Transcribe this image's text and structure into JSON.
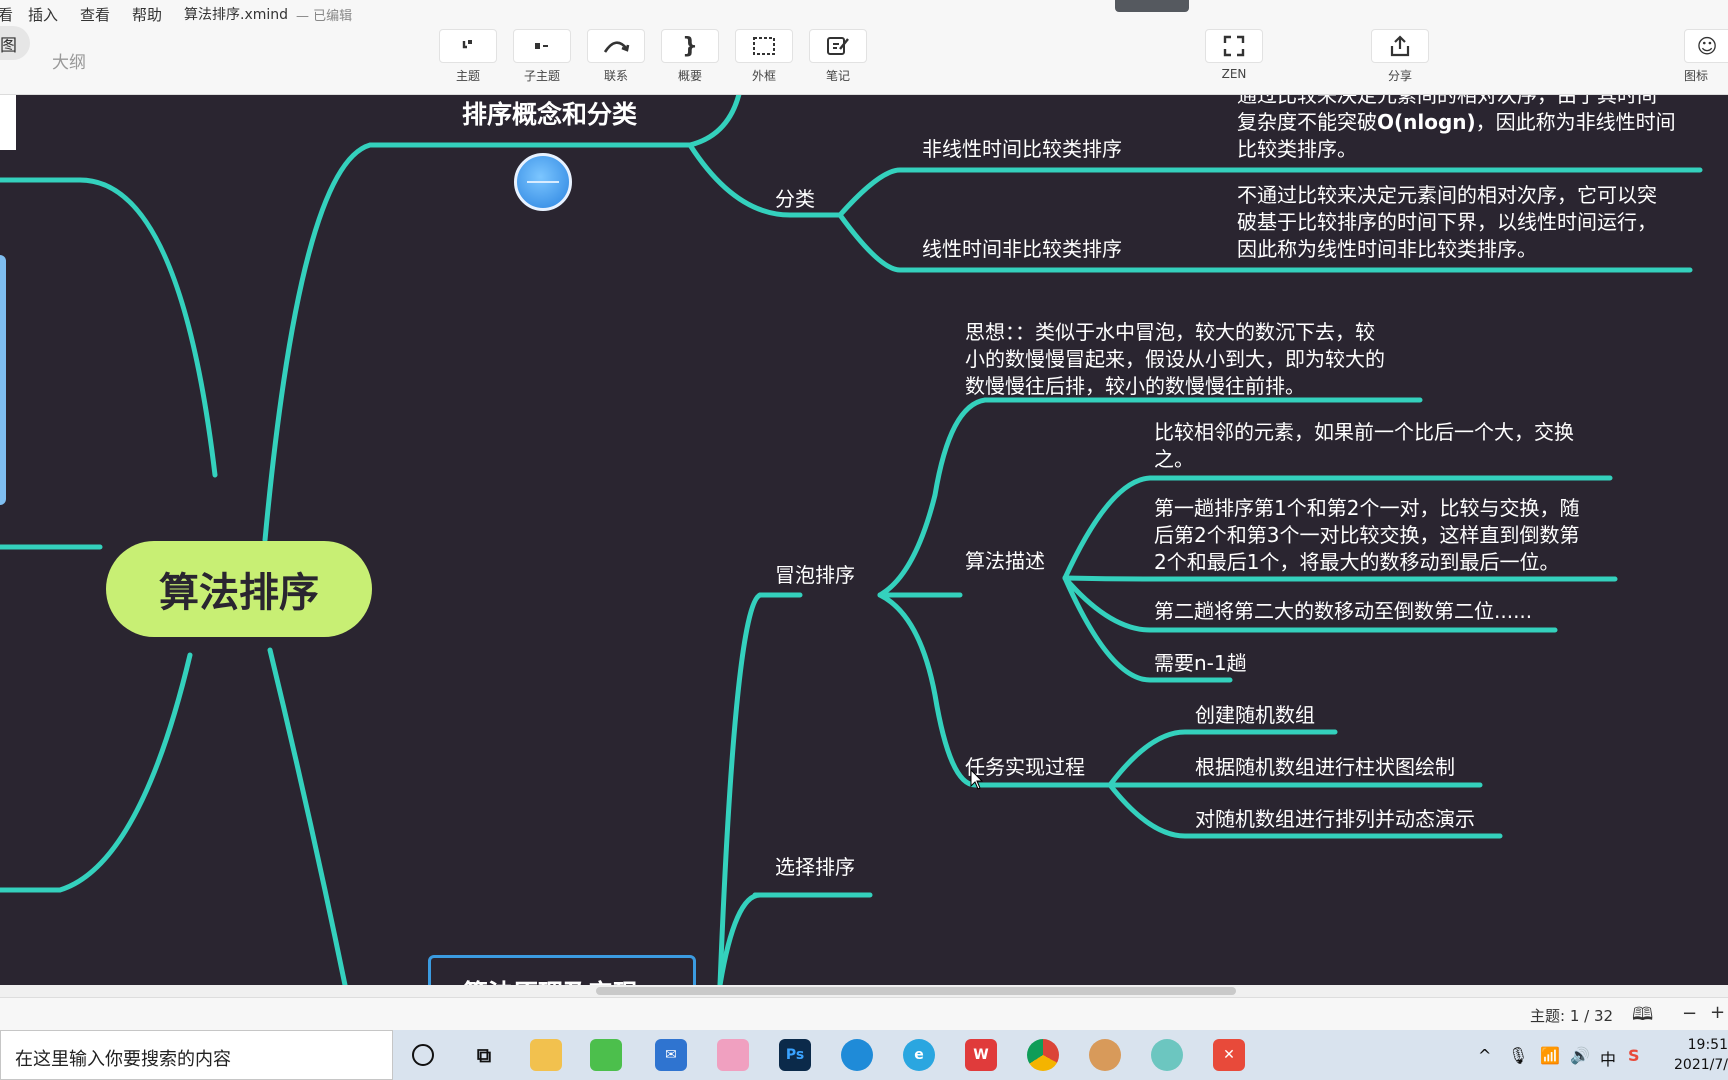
{
  "menubar": {
    "items": [
      "看",
      "插入",
      "查看",
      "帮助"
    ],
    "file_title": "算法排序.xmind",
    "edited": "— 已编辑"
  },
  "toolbar": {
    "view_tabs": {
      "map": "图",
      "outline": "大纲"
    },
    "buttons": [
      {
        "label": "主题",
        "icon": "topic-icon"
      },
      {
        "label": "子主题",
        "icon": "subtopic-icon"
      },
      {
        "label": "联系",
        "icon": "relationship-icon"
      },
      {
        "label": "概要",
        "icon": "summary-icon"
      },
      {
        "label": "外框",
        "icon": "boundary-icon"
      },
      {
        "label": "笔记",
        "icon": "note-icon"
      }
    ],
    "zen_label": "ZEN",
    "share_label": "分享",
    "icon_label": "图标"
  },
  "mindmap": {
    "root": "算法排序",
    "concept_node": "排序概念和分类",
    "classify": "分类",
    "nonlinear": "非线性时间比较类排序",
    "nonlinear_desc_1": "通过比较来决定元素间的相对次序，由于其时间",
    "nonlinear_desc_2": "复杂度不能突破",
    "nonlinear_desc_bold": "O(nlogn)",
    "nonlinear_desc_3": "，因此称为非线性时间",
    "nonlinear_desc_4": "比较类排序。",
    "linear": "线性时间非比较类排序",
    "linear_desc_1": "不通过比较来决定元素间的相对次序，它可以突",
    "linear_desc_2": "破基于比较排序的时间下界，以线性时间运行，",
    "linear_desc_3": "因此称为线性时间非比较类排序。",
    "bubble": "冒泡排序",
    "idea_1": "思想：：类似于水中冒泡，较大的数沉下去，较",
    "idea_2": "小的数慢慢冒起来，假设从小到大，即为较大的",
    "idea_3": "数慢慢往后排，较小的数慢慢往前排。",
    "algo_desc": "算法描述",
    "step1_1": "比较相邻的元素，如果前一个比后一个大，交换",
    "step1_2": "之。",
    "step2_1": "第一趟排序第1个和第2个一对，比较与交换，随",
    "step2_2": "后第2个和第3个一对比较交换，这样直到倒数第",
    "step2_3": "2个和最后1个，将最大的数移动到最后一位。",
    "step3": "第二趟将第二大的数移动至倒数第二位......",
    "step4": "需要n-1趟",
    "task": "任务实现过程",
    "task1": "创建随机数组",
    "task2": "根据随机数组进行柱状图绘制",
    "task3": "对随机数组进行排列并动态演示",
    "selection": "选择排序",
    "principle_node": "算法原理及实现"
  },
  "statusbar": {
    "topic_count": "主题: 1 / 32",
    "zoom_out": "−",
    "zoom_in": "+"
  },
  "taskbar": {
    "search_placeholder": "在这里输入你要搜索的内容",
    "ime_mode": "中",
    "time": "19:51",
    "date": "2021/7/"
  },
  "ime": {
    "label": "中",
    "punct": "°,"
  },
  "colors": {
    "canvas": "#2a2530",
    "branch": "#34d1bd",
    "root_fill": "#c8ef74",
    "accent_blue": "#3b9be0"
  }
}
